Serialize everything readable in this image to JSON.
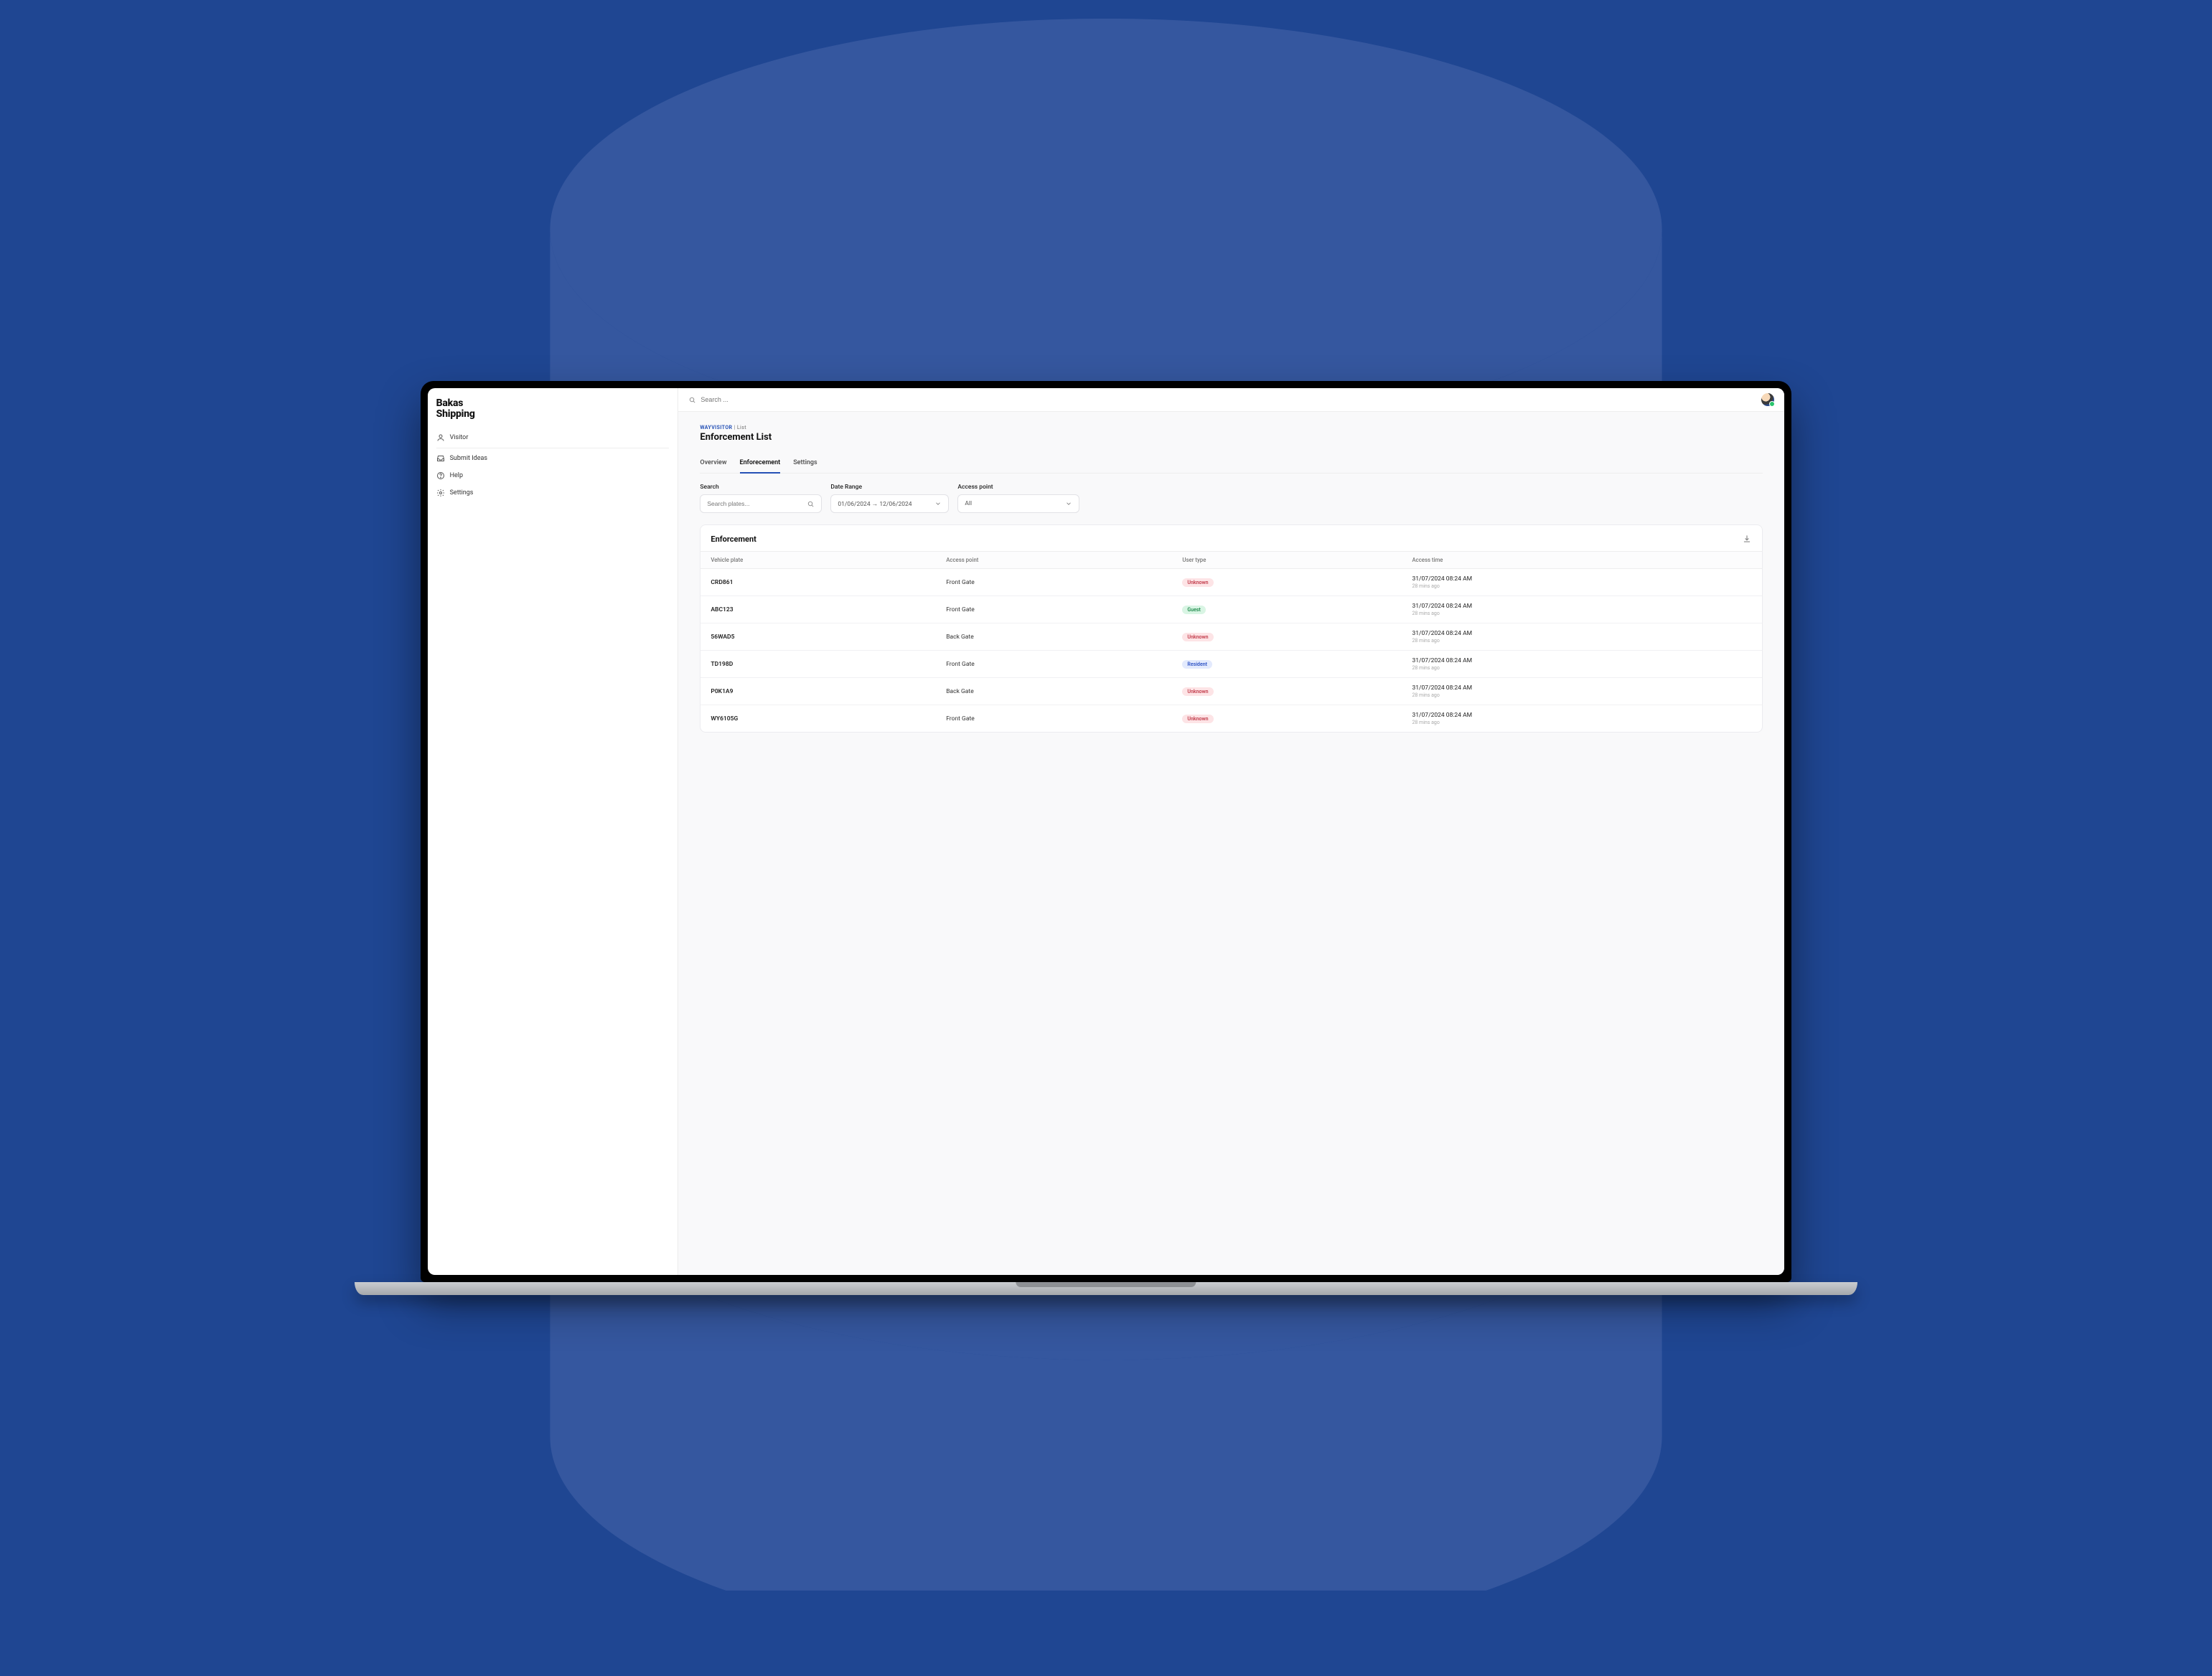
{
  "brand": {
    "line1": "Bakas",
    "line2": "Shipping"
  },
  "topbar": {
    "search_placeholder": "Search ..."
  },
  "sidebar": {
    "items": [
      {
        "label": "Visitor",
        "icon": "person"
      },
      {
        "label": "Submit Ideas",
        "icon": "inbox"
      },
      {
        "label": "Help",
        "icon": "question"
      },
      {
        "label": "Settings",
        "icon": "gear"
      }
    ]
  },
  "breadcrumb": {
    "root": "WAYVISITOR",
    "sep": "|",
    "leaf": "List"
  },
  "page_title": "Enforcement List",
  "tabs": [
    {
      "label": "Overview",
      "active": false
    },
    {
      "label": "Enforecement",
      "active": true
    },
    {
      "label": "Settings",
      "active": false
    }
  ],
  "filters": {
    "search": {
      "label": "Search",
      "placeholder": "Search plates..."
    },
    "date_range": {
      "label": "Date Range",
      "from": "01/06/2024",
      "arrow": "→",
      "to": "12/06/2024"
    },
    "access_point": {
      "label": "Access point",
      "value": "All"
    }
  },
  "table": {
    "title": "Enforcement",
    "columns": [
      "Vehicle plate",
      "Access point",
      "User type",
      "Access time"
    ],
    "rows": [
      {
        "plate": "CRD861",
        "access_point": "Front Gate",
        "user_type": "Unknown",
        "time": "31/07/2024 08:24 AM",
        "rel": "28 mins ago"
      },
      {
        "plate": "ABC123",
        "access_point": "Front Gate",
        "user_type": "Guest",
        "time": "31/07/2024 08:24 AM",
        "rel": "28 mins ago"
      },
      {
        "plate": "56WAD5",
        "access_point": "Back Gate",
        "user_type": "Unknown",
        "time": "31/07/2024 08:24 AM",
        "rel": "28 mins ago"
      },
      {
        "plate": "TD198D",
        "access_point": "Front Gate",
        "user_type": "Resident",
        "time": "31/07/2024 08:24 AM",
        "rel": "28 mins ago"
      },
      {
        "plate": "P0K1A9",
        "access_point": "Back Gate",
        "user_type": "Unknown",
        "time": "31/07/2024 08:24 AM",
        "rel": "28 mins ago"
      },
      {
        "plate": "WY6105G",
        "access_point": "Front Gate",
        "user_type": "Unknown",
        "time": "31/07/2024 08:24 AM",
        "rel": "28 mins ago"
      }
    ]
  }
}
